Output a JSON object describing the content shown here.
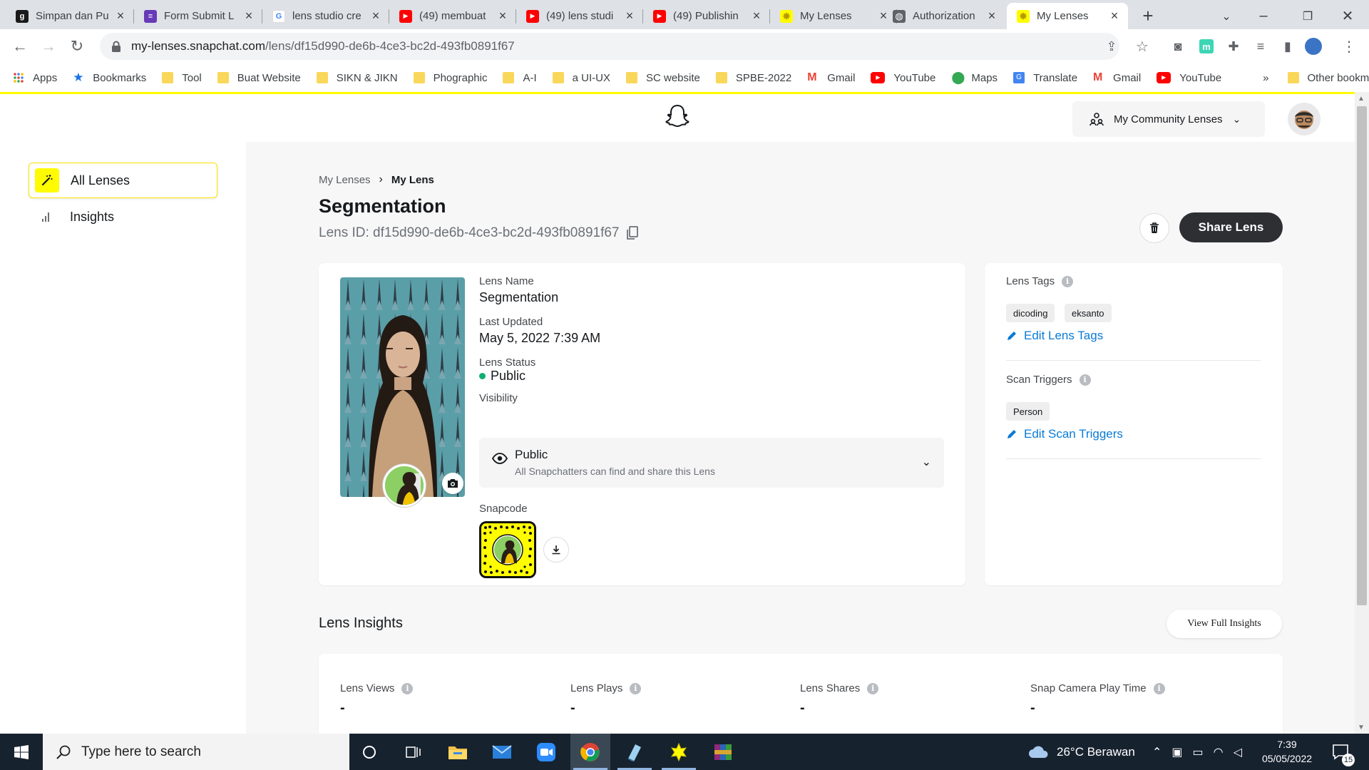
{
  "browser": {
    "tabs": [
      {
        "title": "Simpan dan Pu",
        "icon": "g-icon",
        "color": "#1a1a1a",
        "letter": "g"
      },
      {
        "title": "Form Submit L",
        "icon": "forms-icon",
        "color": "#673ab7",
        "letter": "≡"
      },
      {
        "title": "lens studio cre",
        "icon": "google-icon",
        "color": "#ffffff",
        "letter": "G"
      },
      {
        "title": "(49) membuat",
        "icon": "youtube-icon",
        "color": "#ff0000",
        "letter": "▶"
      },
      {
        "title": "(49) lens studi",
        "icon": "youtube-icon",
        "color": "#ff0000",
        "letter": "▶"
      },
      {
        "title": "(49) Publishin",
        "icon": "youtube-icon",
        "color": "#ff0000",
        "letter": "▶"
      },
      {
        "title": "My Lenses",
        "icon": "snap-star-icon",
        "color": "#fffc00",
        "letter": "✸"
      },
      {
        "title": "Authorization",
        "icon": "globe-icon",
        "color": "#5f6368",
        "letter": "◍"
      },
      {
        "title": "My Lenses",
        "icon": "snap-star-icon",
        "color": "#fffc00",
        "letter": "✸"
      }
    ],
    "url_host": "my-lenses.snapchat.com",
    "url_path": "/lens/df15d990-de6b-4ce3-bc2d-493fb0891f67"
  },
  "bookmarks": [
    {
      "label": "Apps",
      "icon": "apps-grid-icon"
    },
    {
      "label": "Bookmarks",
      "icon": "star-icon"
    },
    {
      "label": "Tool",
      "icon": "folder-icon"
    },
    {
      "label": "Buat Website",
      "icon": "folder-icon"
    },
    {
      "label": "SIKN & JIKN",
      "icon": "folder-icon"
    },
    {
      "label": "Phographic",
      "icon": "folder-icon"
    },
    {
      "label": "A-I",
      "icon": "folder-icon"
    },
    {
      "label": "a UI-UX",
      "icon": "folder-icon"
    },
    {
      "label": "SC website",
      "icon": "folder-icon"
    },
    {
      "label": "SPBE-2022",
      "icon": "folder-icon"
    },
    {
      "label": "Gmail",
      "icon": "gmail-icon"
    },
    {
      "label": "YouTube",
      "icon": "youtube-icon"
    },
    {
      "label": "Maps",
      "icon": "maps-icon"
    },
    {
      "label": "Translate",
      "icon": "translate-icon"
    },
    {
      "label": "Gmail",
      "icon": "gmail-icon"
    },
    {
      "label": "YouTube",
      "icon": "youtube-icon"
    }
  ],
  "bookmarks_more": "»",
  "other_bookmarks": "Other bookmarks",
  "header": {
    "community_label": "My Community Lenses"
  },
  "sidebar": {
    "items": [
      {
        "label": "All Lenses",
        "icon": "magic-wand-icon",
        "active": true
      },
      {
        "label": "Insights",
        "icon": "bar-chart-icon",
        "active": false
      }
    ]
  },
  "page": {
    "breadcrumb_parent": "My Lenses",
    "breadcrumb_current": "My Lens",
    "title": "Segmentation",
    "lens_id": "Lens ID: df15d990-de6b-4ce3-bc2d-493fb0891f67",
    "share_label": "Share Lens"
  },
  "details": {
    "name_label": "Lens Name",
    "name_value": "Segmentation",
    "updated_label": "Last Updated",
    "updated_value": "May 5, 2022 7:39 AM",
    "status_label": "Lens Status",
    "status_value": "Public",
    "visibility_label": "Visibility",
    "visibility_title": "Public",
    "visibility_sub": "All Snapchatters can find and share this Lens",
    "snapcode_label": "Snapcode"
  },
  "tags": {
    "lens_tags_label": "Lens Tags",
    "tags": [
      "dicoding",
      "eksanto"
    ],
    "edit_tags": "Edit Lens Tags",
    "triggers_label": "Scan Triggers",
    "triggers": [
      "Person"
    ],
    "edit_triggers": "Edit Scan Triggers"
  },
  "insights": {
    "title": "Lens Insights",
    "full_label": "View Full Insights",
    "metrics": [
      {
        "label": "Lens Views",
        "value": "-"
      },
      {
        "label": "Lens Plays",
        "value": "-"
      },
      {
        "label": "Lens Shares",
        "value": "-"
      },
      {
        "label": "Snap Camera Play Time",
        "value": "-"
      }
    ]
  },
  "taskbar": {
    "search_placeholder": "Type here to search",
    "weather": "26°C  Berawan",
    "time": "7:39",
    "date": "05/05/2022",
    "notifications": "15"
  },
  "colors": {
    "snap_yellow": "#fffc00",
    "link_blue": "#0a7bd6",
    "status_green": "#0fae72",
    "dark_button": "#2d2f33"
  }
}
